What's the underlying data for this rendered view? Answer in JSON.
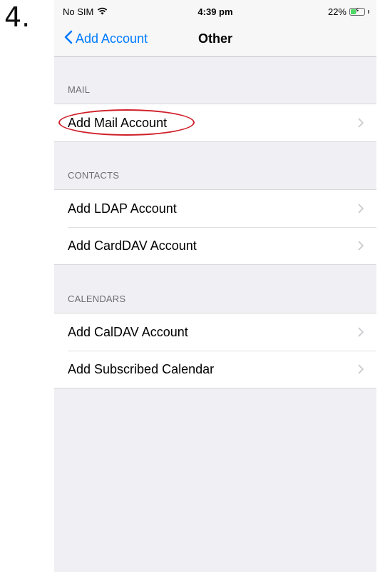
{
  "step_number": "4.",
  "status_bar": {
    "carrier": "No SIM",
    "time": "4:39 pm",
    "battery_percent": "22%"
  },
  "nav": {
    "back_label": "Add Account",
    "title": "Other"
  },
  "sections": {
    "mail": {
      "header": "MAIL",
      "items": [
        "Add Mail Account"
      ]
    },
    "contacts": {
      "header": "CONTACTS",
      "items": [
        "Add LDAP Account",
        "Add CardDAV Account"
      ]
    },
    "calendars": {
      "header": "CALENDARS",
      "items": [
        "Add CalDAV Account",
        "Add Subscribed Calendar"
      ]
    }
  },
  "colors": {
    "accent": "#007aff",
    "highlight": "#d0202a",
    "background": "#efeff4"
  }
}
